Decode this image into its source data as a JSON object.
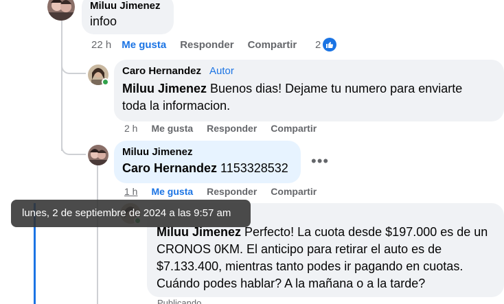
{
  "comments": [
    {
      "author": "Miluu Jimenez",
      "text": "infoo",
      "time": "22 h",
      "like_label": "Me gusta",
      "reply_label": "Responder",
      "share_label": "Compartir",
      "reaction_count": "2"
    },
    {
      "author": "Caro Hernandez",
      "badge": "Autor",
      "mention": "Miluu Jimenez",
      "text_line1": " Buenos dias! Dejame tu numero para enviarte",
      "text_line2": "toda la informacion.",
      "time": "2 h",
      "like_label": "Me gusta",
      "reply_label": "Responder",
      "share_label": "Compartir"
    },
    {
      "author": "Miluu Jimenez",
      "mention": "Caro Hernandez",
      "text": " 1153328532",
      "time": "1 h",
      "like_label": "Me gusta",
      "reply_label": "Responder",
      "share_label": "Compartir",
      "more_icon": "more-dots-icon"
    },
    {
      "mention": "Miluu Jimenez",
      "text_line1": " Perfecto! La cuota desde $197.000 es de un",
      "text_line2": "CRONOS 0KM. El anticipo para retirar el auto es de",
      "text_line3": "$7.133.400, mientras tanto podes ir pagando en cuotas.",
      "text_line4": "Cuándo podes hablar? A la mañana o a la tarde?",
      "status": "Publicando..."
    }
  ],
  "tooltip": "lunes, 2 de septiembre de 2024 a las 9:57 am",
  "colors": {
    "accent": "#1b74e4",
    "bubble": "#f0f2f5",
    "highlight_bubble": "#e7f3ff",
    "muted_text": "#65676b",
    "online": "#31a24c"
  }
}
